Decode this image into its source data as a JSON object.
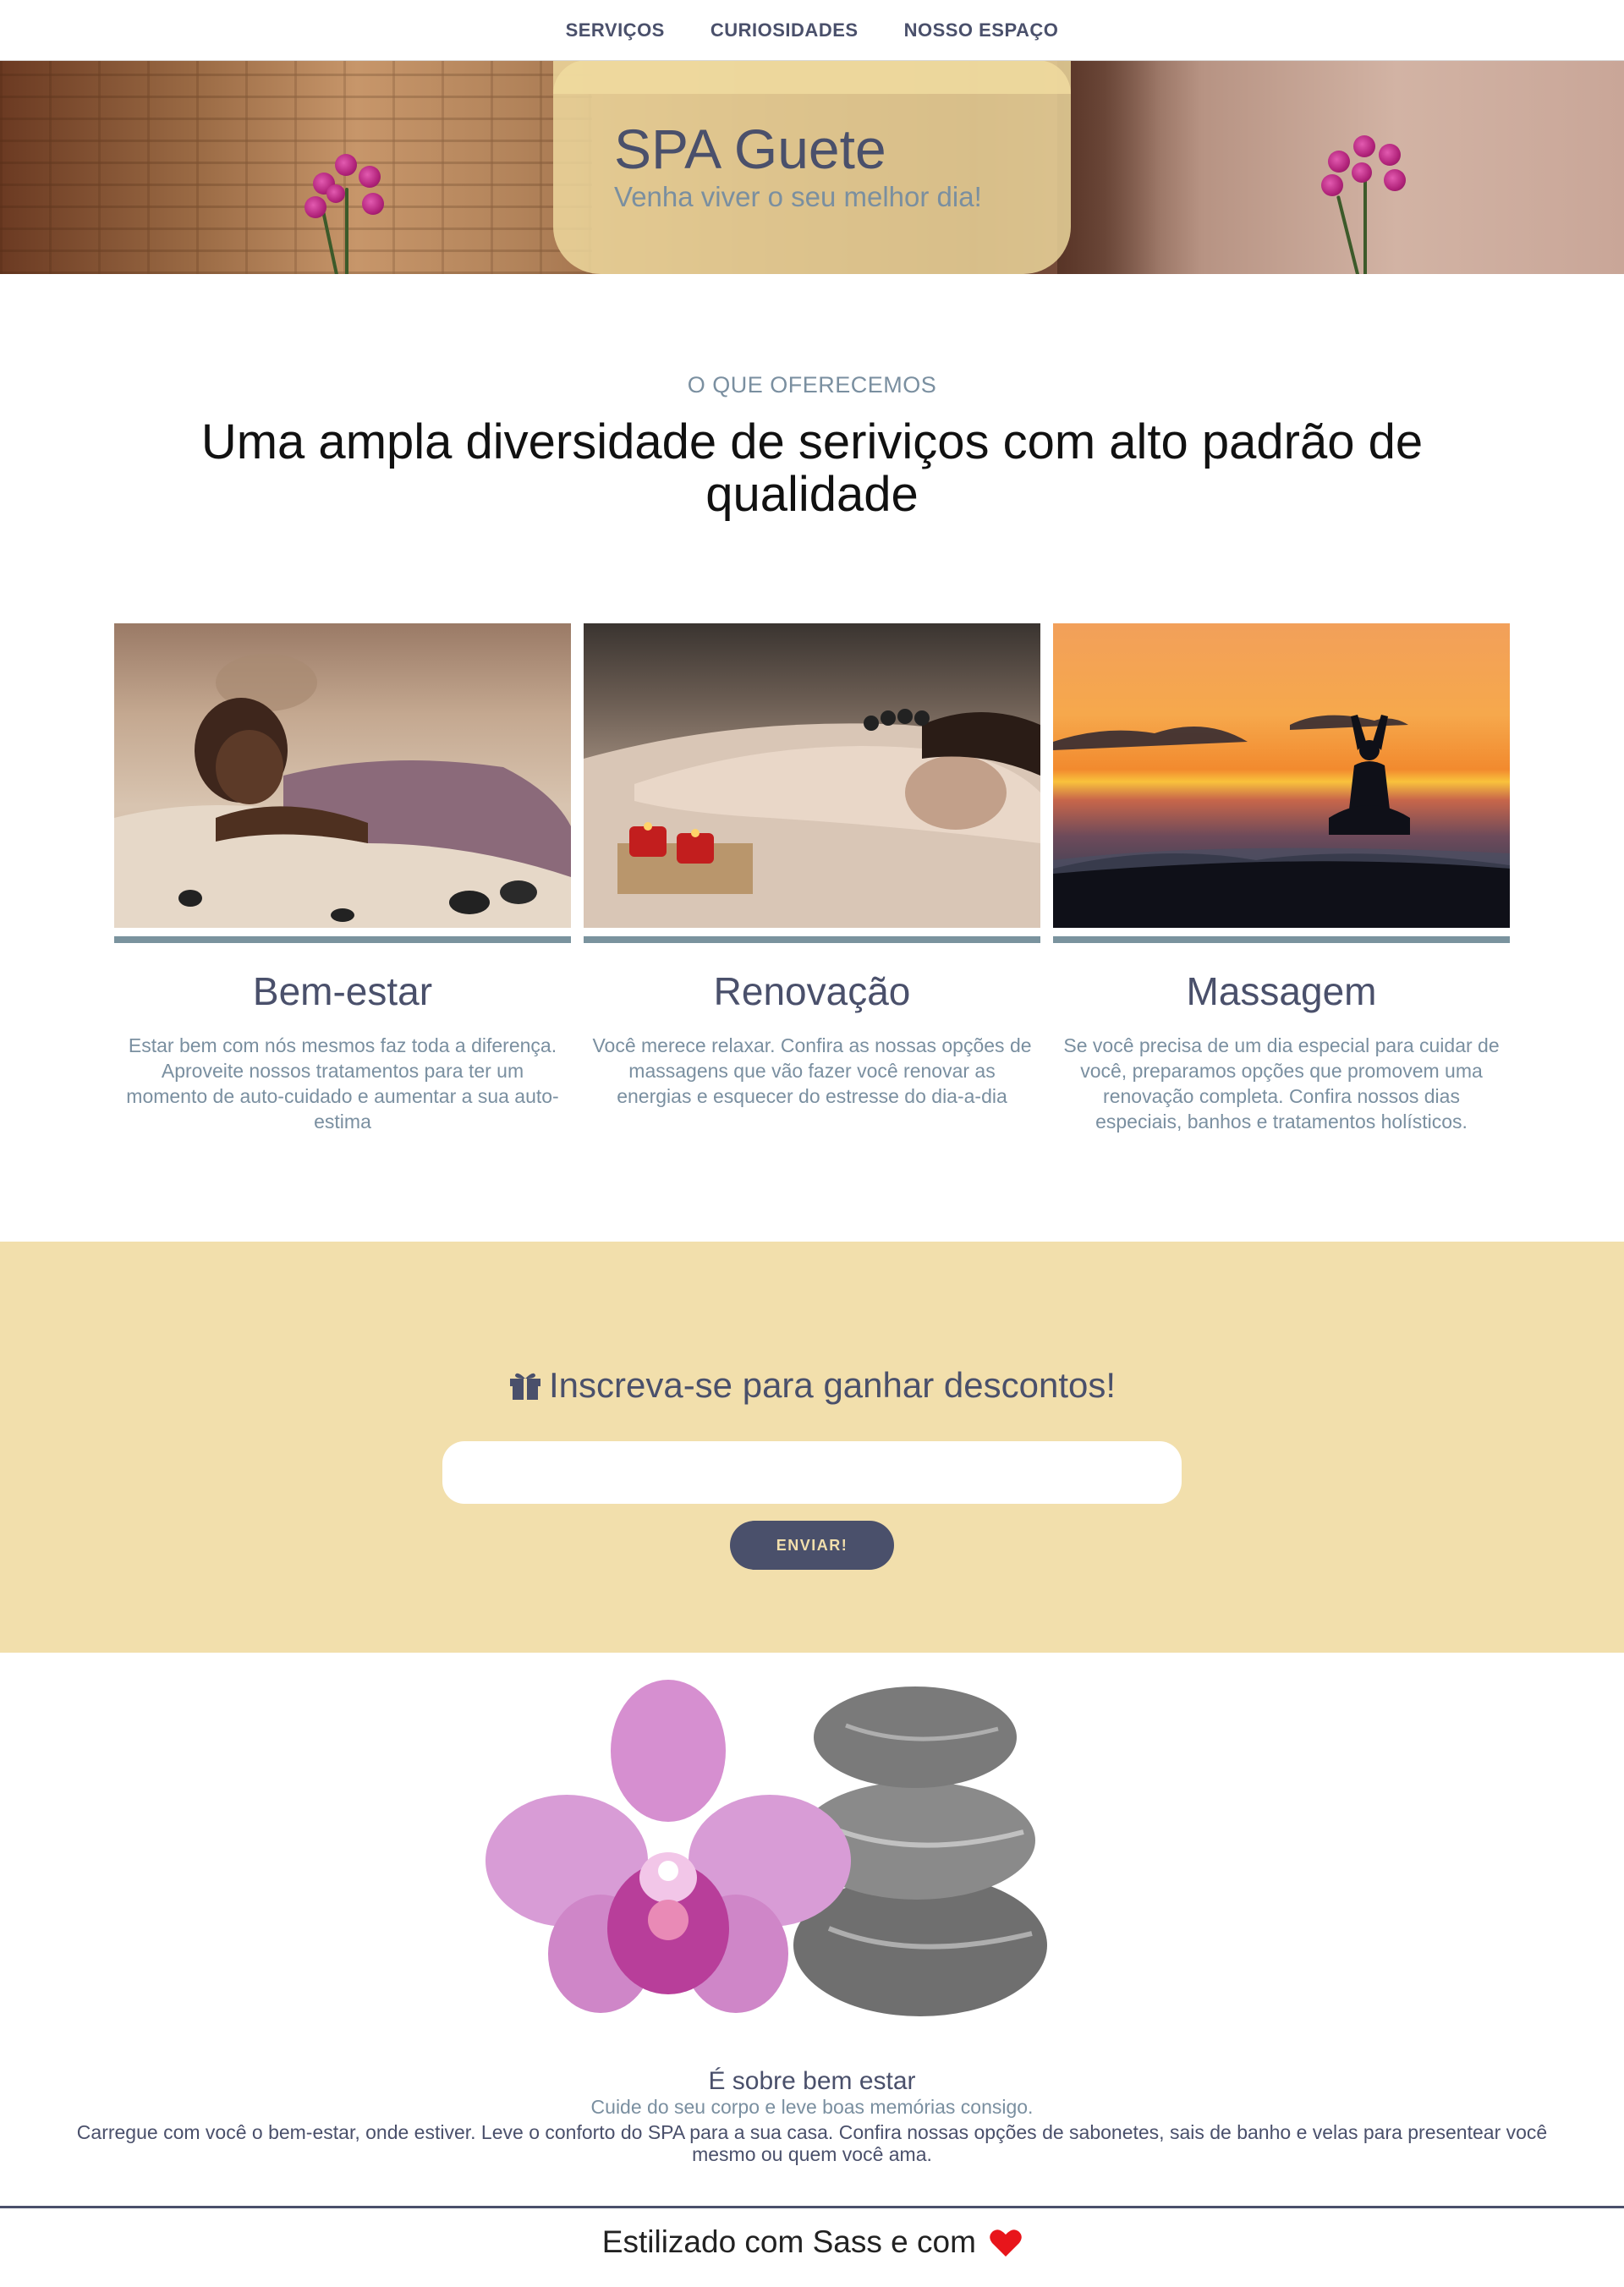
{
  "nav": {
    "items": [
      {
        "label": "SERVIÇOS"
      },
      {
        "label": "CURIOSIDADES"
      },
      {
        "label": "NOSSO ESPAÇO"
      }
    ]
  },
  "hero": {
    "title": "SPA Guete",
    "subtitle": "Venha viver o seu melhor dia!"
  },
  "intro": {
    "eyebrow": "O QUE OFERECEMOS",
    "headline": "Uma ampla diversidade de seriviços com alto padrão de qualidade"
  },
  "services": [
    {
      "title": "Bem-estar",
      "text": "Estar bem com nós mesmos faz toda a diferença. Aproveite nossos tratamentos para ter um momento de auto-cuidado e aumentar a sua auto-estima"
    },
    {
      "title": "Renovação",
      "text": "Você merece relaxar. Confira as nossas opções de massagens que vão fazer você renovar as energias e esquecer do estresse do dia-a-dia"
    },
    {
      "title": "Massagem",
      "text": "Se você precisa de um dia especial para cuidar de você, preparamos opções que promovem uma renovação completa. Confira nossos dias especiais, banhos e tratamentos holísticos."
    }
  ],
  "subscribe": {
    "title": "Inscreva-se para ganhar descontos!",
    "icon": "gift-icon",
    "input_value": "",
    "button_label": "ENVIAR!"
  },
  "feature": {
    "heading": "É sobre bem estar",
    "subheading": "Cuide do seu corpo e leve boas memórias consigo.",
    "text": "Carregue com você o bem-estar, onde estiver. Leve o conforto do SPA para a sua casa. Confira nossas opções de sabonetes, sais de banho e velas para presentear você mesmo ou quem você ama."
  },
  "footer": {
    "text": "Estilizado com Sass e com",
    "icon": "heart-icon"
  },
  "colors": {
    "primary": "#4a506b",
    "muted": "#7a8fa0",
    "sand": "#f2dfac",
    "heart": "#e8151b"
  }
}
